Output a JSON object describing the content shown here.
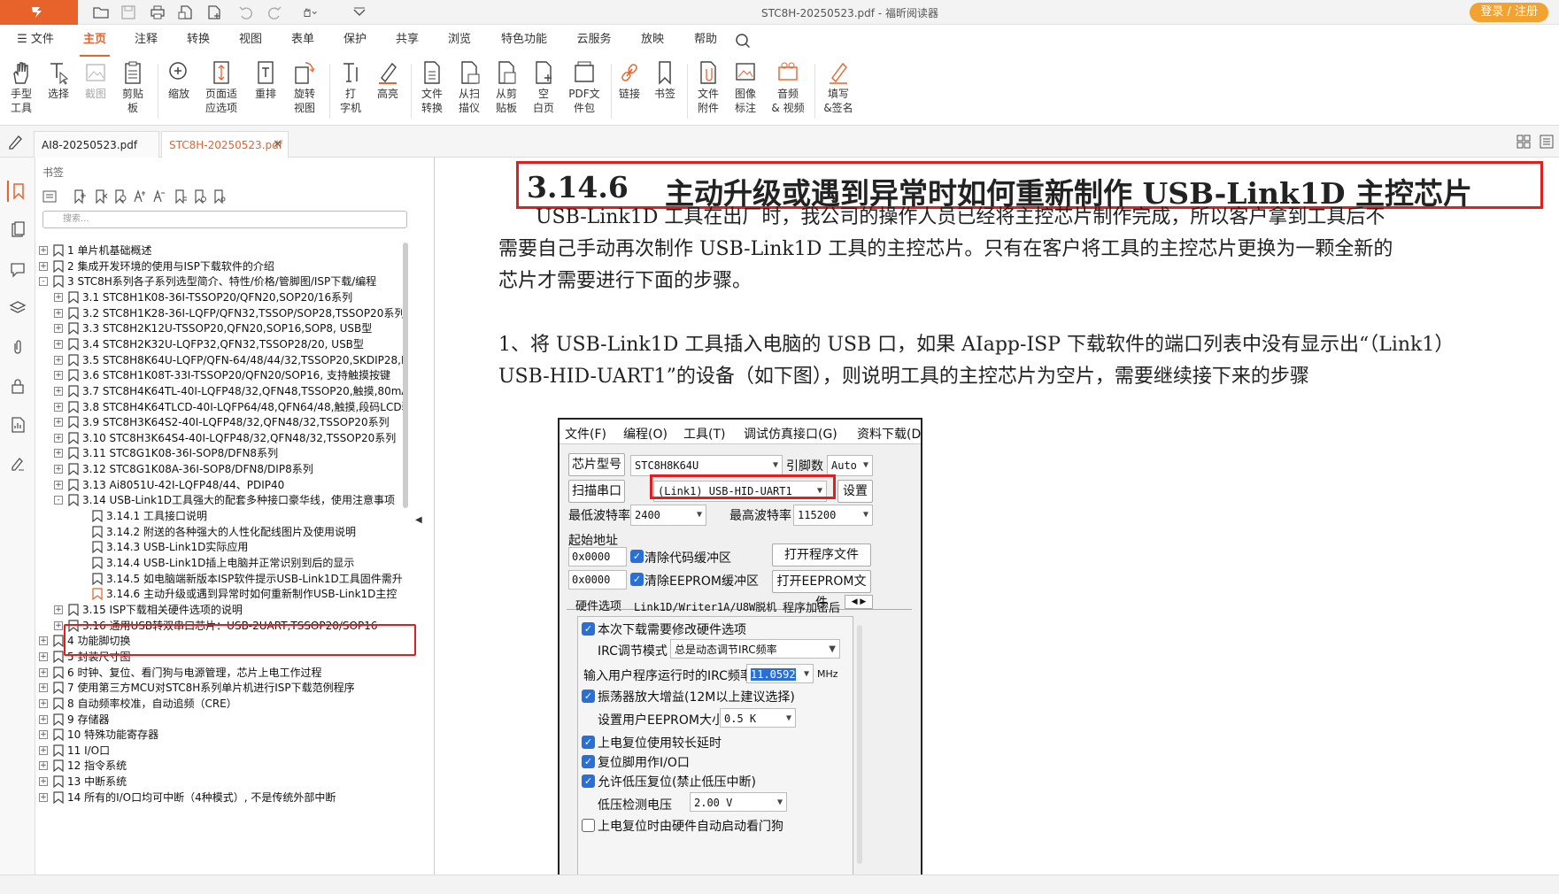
{
  "window": {
    "title": "STC8H-20250523.pdf - 福昕阅读器",
    "login_label": "登录 / 注册"
  },
  "menus": [
    "文件",
    "主页",
    "注释",
    "转换",
    "视图",
    "表单",
    "保护",
    "共享",
    "浏览",
    "特色功能",
    "云服务",
    "放映",
    "帮助"
  ],
  "ribbon": [
    {
      "l1": "手型",
      "l2": "工具",
      "icon": "hand-icon"
    },
    {
      "l1": "选择",
      "l2": "",
      "icon": "select-icon"
    },
    {
      "l1": "截图",
      "l2": "",
      "icon": "screenshot-icon"
    },
    {
      "l1": "剪贴",
      "l2": "板",
      "icon": "clipboard-icon"
    },
    {
      "l1": "缩放",
      "l2": "",
      "icon": "zoom-icon"
    },
    {
      "l1": "页面适",
      "l2": "应选项",
      "icon": "fit-page-icon"
    },
    {
      "l1": "重排",
      "l2": "",
      "icon": "reflow-icon"
    },
    {
      "l1": "旋转",
      "l2": "视图",
      "icon": "rotate-icon"
    },
    {
      "l1": "打",
      "l2": "字机",
      "icon": "typewriter-icon"
    },
    {
      "l1": "高亮",
      "l2": "",
      "icon": "highlight-icon"
    },
    {
      "l1": "文件",
      "l2": "转换",
      "icon": "file-convert-icon"
    },
    {
      "l1": "从扫",
      "l2": "描仪",
      "icon": "scanner-icon"
    },
    {
      "l1": "从剪",
      "l2": "贴板",
      "icon": "from-clipboard-icon"
    },
    {
      "l1": "空",
      "l2": "白页",
      "icon": "blank-page-icon"
    },
    {
      "l1": "PDF文",
      "l2": "件包",
      "icon": "pdf-package-icon"
    },
    {
      "l1": "链接",
      "l2": "",
      "icon": "link-icon"
    },
    {
      "l1": "书签",
      "l2": "",
      "icon": "bookmark-icon"
    },
    {
      "l1": "文件",
      "l2": "附件",
      "icon": "attachment-icon"
    },
    {
      "l1": "图像",
      "l2": "标注",
      "icon": "image-annot-icon"
    },
    {
      "l1": "音频",
      "l2": "& 视频",
      "icon": "media-icon"
    },
    {
      "l1": "填写",
      "l2": "&签名",
      "icon": "sign-icon"
    }
  ],
  "tabs": [
    {
      "label": "AI8-20250523.pdf",
      "active": false
    },
    {
      "label": "STC8H-20250523.pdf",
      "active": true
    }
  ],
  "bookmarks": {
    "title": "书签",
    "search_placeholder": "搜索...",
    "items": [
      {
        "level": 0,
        "exp": "+",
        "label": "1 单片机基础概述"
      },
      {
        "level": 0,
        "exp": "+",
        "label": "2 集成开发环境的使用与ISP下载软件的介绍"
      },
      {
        "level": 0,
        "exp": "-",
        "label": "3 STC8H系列各子系列选型简介、特性/价格/管脚图/ISP下载/编程"
      },
      {
        "level": 1,
        "exp": "+",
        "label": "3.1 STC8H1K08-36I-TSSOP20/QFN20,SOP20/16系列"
      },
      {
        "level": 1,
        "exp": "+",
        "label": "3.2 STC8H1K28-36I-LQFP/QFN32,TSSOP/SOP28,TSSOP20系列"
      },
      {
        "level": 1,
        "exp": "+",
        "label": "3.3 STC8H2K12U-TSSOP20,QFN20,SOP16,SOP8, USB型"
      },
      {
        "level": 1,
        "exp": "+",
        "label": "3.4 STC8H2K32U-LQFP32,QFN32,TSSOP28/20, USB型"
      },
      {
        "level": 1,
        "exp": "+",
        "label": "3.5 STC8H8K64U-LQFP/QFN-64/48/44/32,TSSOP20,SKDIP28,PDIP4("
      },
      {
        "level": 1,
        "exp": "+",
        "label": "3.6 STC8H1K08T-33I-TSSOP20/QFN20/SOP16, 支持触摸按键"
      },
      {
        "level": 1,
        "exp": "+",
        "label": "3.7 STC8H4K64TL-40I-LQFP48/32,QFN48,TSSOP20,触摸,80mA大电"
      },
      {
        "level": 1,
        "exp": "+",
        "label": "3.8 STC8H4K64TLCD-40I-LQFP64/48,QFN64/48,触摸,段码LCD驱动"
      },
      {
        "level": 1,
        "exp": "+",
        "label": "3.9 STC8H3K64S2-40I-LQFP48/32,QFN48/32,TSSOP20系列"
      },
      {
        "level": 1,
        "exp": "+",
        "label": "3.10 STC8H3K64S4-40I-LQFP48/32,QFN48/32,TSSOP20系列"
      },
      {
        "level": 1,
        "exp": "+",
        "label": "3.11 STC8G1K08-36I-SOP8/DFN8系列"
      },
      {
        "level": 1,
        "exp": "+",
        "label": "3.12 STC8G1K08A-36I-SOP8/DFN8/DIP8系列"
      },
      {
        "level": 1,
        "exp": "+",
        "label": "3.13 Ai8051U-42I-LQFP48/44、PDIP40"
      },
      {
        "level": 1,
        "exp": "-",
        "label": "3.14 USB-Link1D工具强大的配套多种接口豪华线，使用注意事项"
      },
      {
        "level": 2,
        "exp": "",
        "label": "3.14.1 工具接口说明"
      },
      {
        "level": 2,
        "exp": "",
        "label": "3.14.2 附送的各种强大的人性化配线图片及使用说明"
      },
      {
        "level": 2,
        "exp": "",
        "label": "3.14.3 USB-Link1D实际应用"
      },
      {
        "level": 2,
        "exp": "",
        "label": "3.14.4 USB-Link1D插上电脑并正常识别到后的显示"
      },
      {
        "level": 2,
        "exp": "",
        "label": "3.14.5 如电脑端新版本ISP软件提示USB-Link1D工具固件需升"
      },
      {
        "level": 2,
        "exp": "",
        "label": "3.14.6 主动升级或遇到异常时如何重新制作USB-Link1D主控"
      },
      {
        "level": 1,
        "exp": "+",
        "label": "3.15 ISP下载相关硬件选项的说明"
      },
      {
        "level": 1,
        "exp": "+",
        "label": "3.16 通用USB转双串口芯片：USB-2UART,TSSOP20/SOP16"
      },
      {
        "level": 0,
        "exp": "+",
        "label": "4 功能脚切换"
      },
      {
        "level": 0,
        "exp": "+",
        "label": "5 封装尺寸图"
      },
      {
        "level": 0,
        "exp": "+",
        "label": "6 时钟、复位、看门狗与电源管理，芯片上电工作过程"
      },
      {
        "level": 0,
        "exp": "+",
        "label": "7 使用第三方MCU对STC8H系列单片机进行ISP下载范例程序"
      },
      {
        "level": 0,
        "exp": "+",
        "label": "8 自动频率校准，自动追频（CRE）"
      },
      {
        "level": 0,
        "exp": "+",
        "label": "9 存储器"
      },
      {
        "level": 0,
        "exp": "+",
        "label": "10 特殊功能寄存器"
      },
      {
        "level": 0,
        "exp": "+",
        "label": "11 I/O口"
      },
      {
        "level": 0,
        "exp": "+",
        "label": "12 指令系统"
      },
      {
        "level": 0,
        "exp": "+",
        "label": "13 中断系统"
      },
      {
        "level": 0,
        "exp": "+",
        "label": "14 所有的I/O口均可中断（4种模式）, 不是传统外部中断"
      }
    ]
  },
  "document": {
    "section_number": "3.14.6",
    "section_title": "主动升级或遇到异常时如何重新制作 USB-Link1D 主控芯片",
    "para1_lines": [
      "USB-Link1D 工具在出厂时，我公司的操作人员已经将主控芯片制作完成，所以客户拿到工具后不",
      "需要自己手动再次制作 USB-Link1D 工具的主控芯片。只有在客户将工具的主控芯片更换为一颗全新的",
      "芯片才需要进行下面的步骤。"
    ],
    "para2_lines": [
      "1、将 USB-Link1D 工具插入电脑的 USB 口，如果 AIapp-ISP 下载软件的端口列表中没有显示出“（Link1）",
      "USB-HID-UART1”的设备（如下图），则说明工具的主控芯片为空片，需要继续接下来的步骤"
    ]
  },
  "isp_window": {
    "menus": [
      "文件(F)",
      "编程(O)",
      "工具(T)",
      "调试仿真接口(G)",
      "资料下载(D"
    ],
    "chip_type_label": "芯片型号",
    "chip_type_value": "STC8H8K64U",
    "pins_label": "引脚数",
    "pins_value": "Auto",
    "scan_port_label": "扫描串口",
    "port_value": "(Link1) USB-HID-UART1",
    "settings_label": "设置",
    "min_baud_label": "最低波特率",
    "min_baud_value": "2400",
    "max_baud_label": "最高波特率",
    "max_baud_value": "115200",
    "start_addr_label": "起始地址",
    "addr1": "0x0000",
    "addr2": "0x0000",
    "clear_code_label": "清除代码缓冲区",
    "clear_eeprom_label": "清除EEPROM缓冲区",
    "open_prog_label": "打开程序文件",
    "open_eeprom_label": "打开EEPROM文件",
    "tabs": [
      "硬件选项",
      "Link1D/Writer1A/U8W脱机",
      "程序加密后"
    ],
    "hw_options": {
      "modify_label": "本次下载需要修改硬件选项",
      "irc_mode_label": "IRC调节模式",
      "irc_mode_value": "总是动态调节IRC频率",
      "irc_freq_label": "输入用户程序运行时的IRC频率",
      "irc_freq_value": "11.0592",
      "irc_freq_unit": "MHz",
      "osc_gain_label": "振荡器放大增益(12M以上建议选择)",
      "eeprom_size_label": "设置用户EEPROM大小",
      "eeprom_size_value": "0.5 K",
      "por_delay_label": "上电复位使用较长延时",
      "reset_pin_label": "复位脚用作I/O口",
      "lvr_label": "允许低压复位(禁止低压中断)",
      "lvd_label": "低压检测电压",
      "lvd_value": "2.00 V",
      "wdt_label": "上电复位时由硬件自动启动看门狗"
    }
  }
}
